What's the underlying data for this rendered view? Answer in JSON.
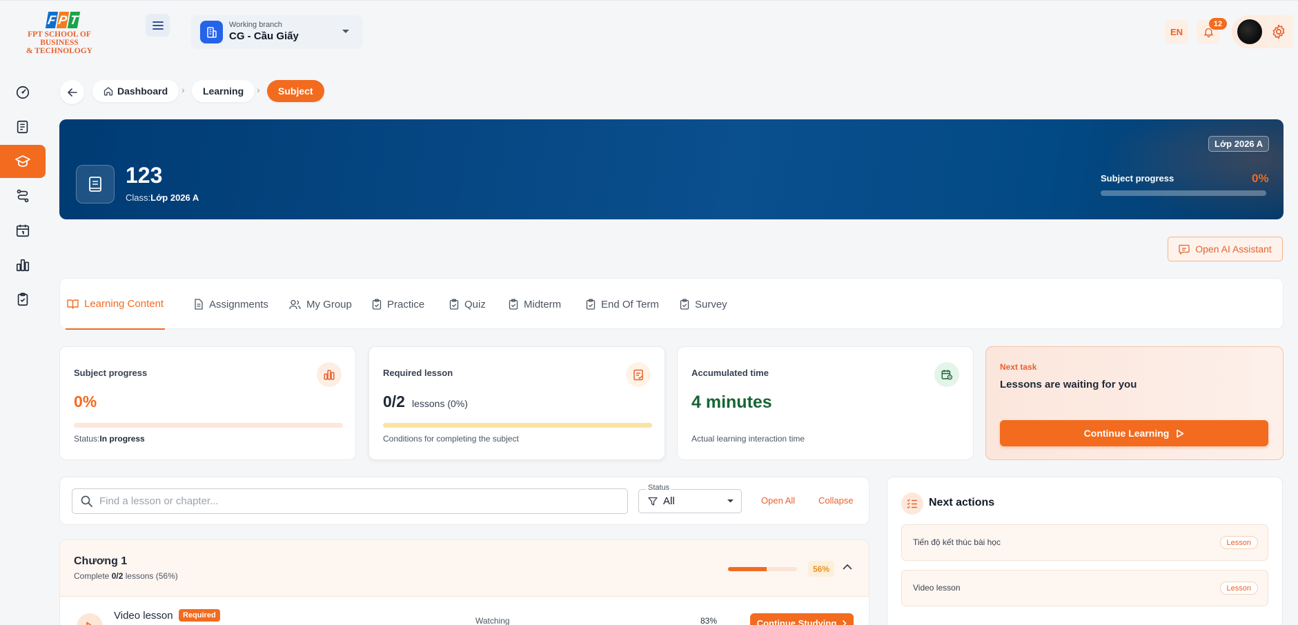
{
  "header": {
    "logo_text": "FPT",
    "school_name": "FPT SCHOOL OF BUSINESS\n& TECHNOLOGY",
    "branch_label": "Working branch",
    "branch_name": "CG - Cầu Giấy",
    "language": "EN",
    "notification_count": "12"
  },
  "sidebar": {
    "items": [
      {
        "icon": "dashboard-icon"
      },
      {
        "icon": "book-icon"
      },
      {
        "icon": "graduation-cap-icon",
        "active": true
      },
      {
        "icon": "route-icon"
      },
      {
        "icon": "calendar-icon"
      },
      {
        "icon": "bar-chart-icon"
      },
      {
        "icon": "clipboard-check-icon"
      }
    ]
  },
  "breadcrumb": {
    "items": [
      "Dashboard",
      "Learning",
      "Subject"
    ],
    "separator": "›"
  },
  "hero": {
    "title": "123",
    "class_label": "Class:",
    "class_name": "Lớp 2026 A",
    "badge": "Lớp 2026 A",
    "progress_label": "Subject progress",
    "progress_value": "0%",
    "progress_fraction": 0
  },
  "ai_assistant": {
    "label": "Open AI Assistant"
  },
  "tabs": [
    {
      "label": "Learning Content",
      "icon": "book-open-icon",
      "active": true
    },
    {
      "label": "Assignments",
      "icon": "document-icon"
    },
    {
      "label": "My Group",
      "icon": "users-icon"
    },
    {
      "label": "Practice",
      "icon": "clipboard-check-icon"
    },
    {
      "label": "Quiz",
      "icon": "clipboard-check-icon"
    },
    {
      "label": "Midterm",
      "icon": "clipboard-check-icon"
    },
    {
      "label": "End Of Term",
      "icon": "clipboard-check-icon"
    },
    {
      "label": "Survey",
      "icon": "clipboard-check-icon"
    }
  ],
  "stats": {
    "subject_progress": {
      "label": "Subject progress",
      "value": "0%",
      "fraction": 0,
      "status_label": "Status:",
      "status_value": "In progress"
    },
    "required_lesson": {
      "label": "Required lesson",
      "value": "0/2",
      "unit": "lessons (0%)",
      "fraction": 0,
      "footer": "Conditions for completing the subject"
    },
    "accumulated_time": {
      "label": "Accumulated time",
      "value": "4 minutes",
      "footer": "Actual learning interaction time"
    },
    "next_task": {
      "label": "Next task",
      "text": "Lessons are waiting for you",
      "button": "Continue Learning"
    }
  },
  "search": {
    "placeholder": "Find a lesson or chapter...",
    "status_label": "Status",
    "status_value": "All",
    "open_all": "Open All",
    "collapse": "Collapse"
  },
  "chapter": {
    "title": "Chương 1",
    "complete_prefix": "Complete",
    "complete_count": "0/2",
    "complete_suffix": "lessons (56%)",
    "progress_value": "56%",
    "progress_fraction": 0.56,
    "lesson": {
      "name": "Video lesson",
      "required": "Required",
      "status": "Watching",
      "percent": "83%",
      "button": "Continue Studying"
    }
  },
  "next_actions": {
    "title": "Next actions",
    "items": [
      {
        "label": "Tiến độ kết thúc bài học",
        "tag": "Lesson"
      },
      {
        "label": "Video lesson",
        "tag": "Lesson"
      }
    ]
  },
  "colors": {
    "accent": "#f26b1f",
    "hero_blue": "#003b73",
    "success_green": "#166534",
    "text_dark": "#1f2937"
  }
}
